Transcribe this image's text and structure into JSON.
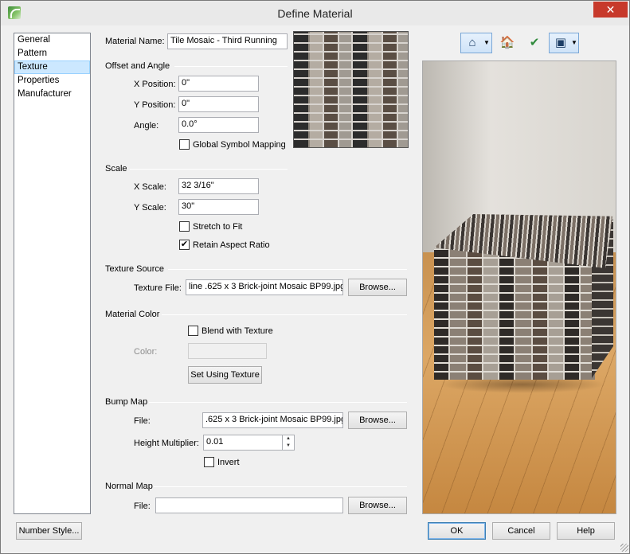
{
  "window": {
    "title": "Define Material",
    "close_glyph": "✕"
  },
  "nav": {
    "items": [
      "General",
      "Pattern",
      "Texture",
      "Properties",
      "Manufacturer"
    ],
    "selected": "Texture"
  },
  "material_name": {
    "label": "Material Name:",
    "value": "Tile Mosaic - Third Running"
  },
  "offset": {
    "section": "Offset and Angle",
    "x_label": "X Position:",
    "x_value": "0\"",
    "y_label": "Y Position:",
    "y_value": "0\"",
    "angle_label": "Angle:",
    "angle_value": "0.0°",
    "global_mapping_label": "Global Symbol Mapping",
    "global_mapping_checked": false
  },
  "scale": {
    "section": "Scale",
    "x_label": "X Scale:",
    "x_value": "32 3/16\"",
    "y_label": "Y Scale:",
    "y_value": "30\"",
    "stretch_label": "Stretch to Fit",
    "stretch_checked": false,
    "retain_label": "Retain Aspect Ratio",
    "retain_checked": true
  },
  "texture_source": {
    "section": "Texture Source",
    "file_label": "Texture File:",
    "file_value": "line .625 x 3 Brick-joint Mosaic BP99.jpg",
    "browse_label": "Browse..."
  },
  "material_color": {
    "section": "Material Color",
    "blend_label": "Blend with Texture",
    "blend_checked": false,
    "color_label": "Color:",
    "set_using_label": "Set Using Texture"
  },
  "bump_map": {
    "section": "Bump Map",
    "file_label": "File:",
    "file_value": ".625 x 3 Brick-joint Mosaic BP99.jpg",
    "browse_label": "Browse...",
    "height_label": "Height Multiplier:",
    "height_value": "0.01",
    "invert_label": "Invert",
    "invert_checked": false
  },
  "normal_map": {
    "section": "Normal Map",
    "file_label": "File:",
    "file_value": "",
    "browse_label": "Browse..."
  },
  "preview_toolbar": {
    "icons": [
      "room-preview-icon",
      "object-preview-icon",
      "texture-checker-icon",
      "cube-preview-icon"
    ]
  },
  "footer": {
    "number_style_label": "Number Style...",
    "ok_label": "OK",
    "cancel_label": "Cancel",
    "help_label": "Help"
  }
}
